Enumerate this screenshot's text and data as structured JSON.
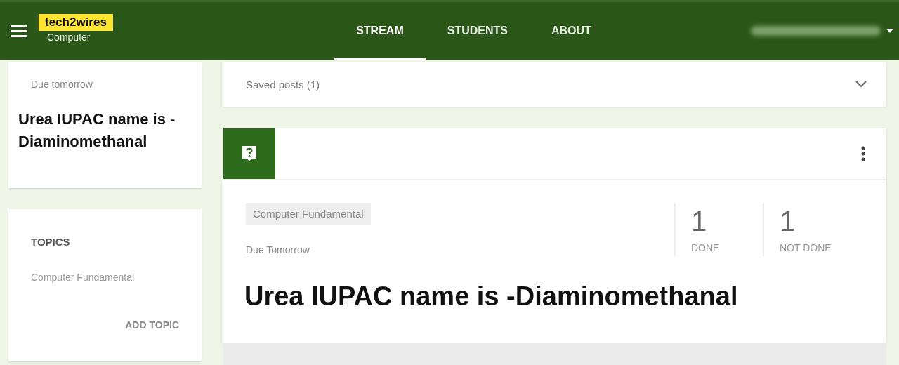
{
  "header": {
    "brand": "tech2wires",
    "class_name": "Computer",
    "tabs": [
      {
        "label": "STREAM",
        "selected": true
      },
      {
        "label": "STUDENTS",
        "selected": false
      },
      {
        "label": "ABOUT",
        "selected": false
      }
    ]
  },
  "upcoming": {
    "due": "Due tomorrow",
    "title": "Urea IUPAC name is -Diaminomethanal"
  },
  "topics": {
    "heading": "TOPICS",
    "items": [
      "Computer Fundamental"
    ],
    "action": "ADD TOPIC"
  },
  "saved_posts": {
    "label": "Saved posts (1)",
    "expanded": false
  },
  "post": {
    "topic": "Computer Fundamental",
    "due": "Due Tomorrow",
    "stats": [
      {
        "count": "1",
        "label": "DONE"
      },
      {
        "count": "1",
        "label": "NOT DONE"
      }
    ],
    "title": "Urea IUPAC name is -Diaminomethanal"
  }
}
